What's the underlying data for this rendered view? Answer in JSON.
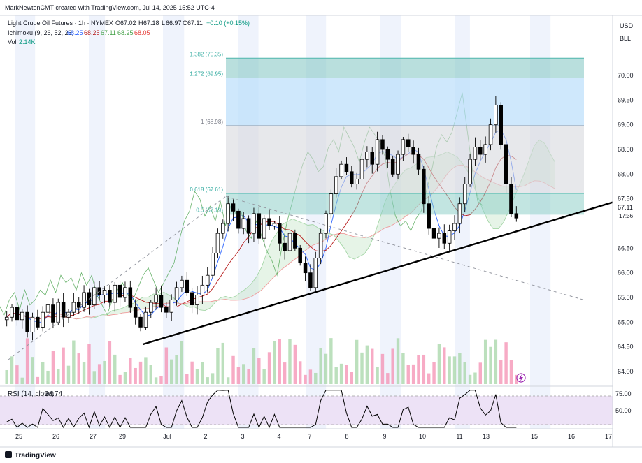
{
  "header": {
    "credit": "MarkNewtonCMT created with TradingView.com, Jul 14, 2025 15:52 UTC-4",
    "instrument": "Light Crude Oil Futures · 1h · NYMEX",
    "ohlc": {
      "open_label": "O",
      "open": "67.02",
      "high_label": "H",
      "high": "67.18",
      "low_label": "L",
      "low": "66.97",
      "close_label": "C",
      "close": "67.11",
      "change": "+0.10 (+0.15%)"
    },
    "ichimoku": {
      "label": "Ichimoku (9, 26, 52, 26)",
      "values": [
        "68.25",
        "68.25",
        "67.11",
        "68.25",
        "68.05"
      ]
    },
    "volume": {
      "label": "Vol",
      "value": "2.14K"
    }
  },
  "price_axis": {
    "currency": "USD",
    "unit": "BLL",
    "ticks": [
      "70.00",
      "69.50",
      "69.00",
      "68.50",
      "68.00",
      "67.50",
      "66.50",
      "66.00",
      "65.50",
      "65.00",
      "64.50",
      "64.00"
    ],
    "last_price": "67.11",
    "countdown": "17:36"
  },
  "time_axis": {
    "ticks": [
      "25",
      "26",
      "27",
      "29",
      "Jul",
      "2",
      "3",
      "4",
      "7",
      "8",
      "9",
      "10",
      "11",
      "13",
      "15",
      "16",
      "17"
    ]
  },
  "fib_levels": [
    {
      "ratio": "1.382",
      "price": "(70.35)",
      "value": 70.35
    },
    {
      "ratio": "1.272",
      "price": "(69.95)",
      "value": 69.95
    },
    {
      "ratio": "1",
      "price": "(68.98)",
      "value": 68.98
    },
    {
      "ratio": "0.618",
      "price": "(67.61)",
      "value": 67.61
    },
    {
      "ratio": "0.5",
      "price": "(67.19)",
      "value": 67.19
    }
  ],
  "rsi": {
    "label": "RSI (14, close)",
    "value": "34.74",
    "ticks": [
      "75.00",
      "50.00"
    ]
  },
  "footer": {
    "brand": "TradingView"
  },
  "colors": {
    "candle": "#000000",
    "volume_up": "#a5d6a7",
    "volume_down": "#f48fb1",
    "conversion": "#2962ff",
    "base": "#b71c1c",
    "lagging": "#43a047",
    "span_a": "#a5d6a7",
    "span_b": "#ef9a9a",
    "fib_blue": "#90caf9",
    "fib_teal": "#4db6ac",
    "rsi_line": "#000000",
    "rsi_band": "#e1bee7"
  },
  "chart_data": {
    "type": "candlestick",
    "y_range": [
      63.85,
      70.6
    ],
    "rsi_range": [
      30,
      90
    ],
    "rsi_band": [
      50,
      75
    ],
    "trendline": {
      "from_price": 64.55,
      "to_price": 67.5
    },
    "dashed_lines": [
      {
        "from_price": 65.0,
        "to_price": 67.55
      },
      {
        "from_price": 67.55,
        "to_price": 65.45
      }
    ],
    "closes": [
      65.1,
      65.3,
      65.05,
      65.2,
      64.8,
      65.1,
      64.9,
      65.2,
      65.35,
      65.0,
      65.4,
      65.1,
      65.2,
      65.4,
      65.3,
      65.6,
      65.35,
      65.7,
      65.55,
      65.65,
      65.4,
      65.75,
      65.5,
      65.7,
      65.3,
      65.1,
      64.9,
      65.2,
      65.4,
      65.55,
      65.3,
      65.2,
      65.45,
      65.7,
      65.85,
      65.6,
      65.35,
      65.55,
      65.75,
      65.95,
      66.4,
      66.8,
      67.0,
      67.4,
      67.25,
      66.9,
      67.1,
      66.8,
      67.2,
      66.7,
      67.1,
      66.95,
      67.0,
      66.6,
      66.45,
      66.8,
      66.5,
      66.2,
      66.0,
      65.7,
      66.3,
      66.8,
      67.2,
      67.6,
      67.95,
      68.2,
      68.05,
      67.8,
      67.9,
      68.3,
      68.45,
      68.2,
      68.7,
      68.5,
      68.3,
      68.0,
      68.4,
      68.7,
      68.55,
      68.4,
      68.1,
      67.4,
      66.9,
      66.7,
      66.8,
      66.6,
      66.85,
      67.0,
      67.4,
      67.8,
      68.3,
      68.55,
      68.4,
      68.6,
      69.0,
      69.4,
      68.6,
      67.8,
      67.2,
      67.11
    ]
  }
}
